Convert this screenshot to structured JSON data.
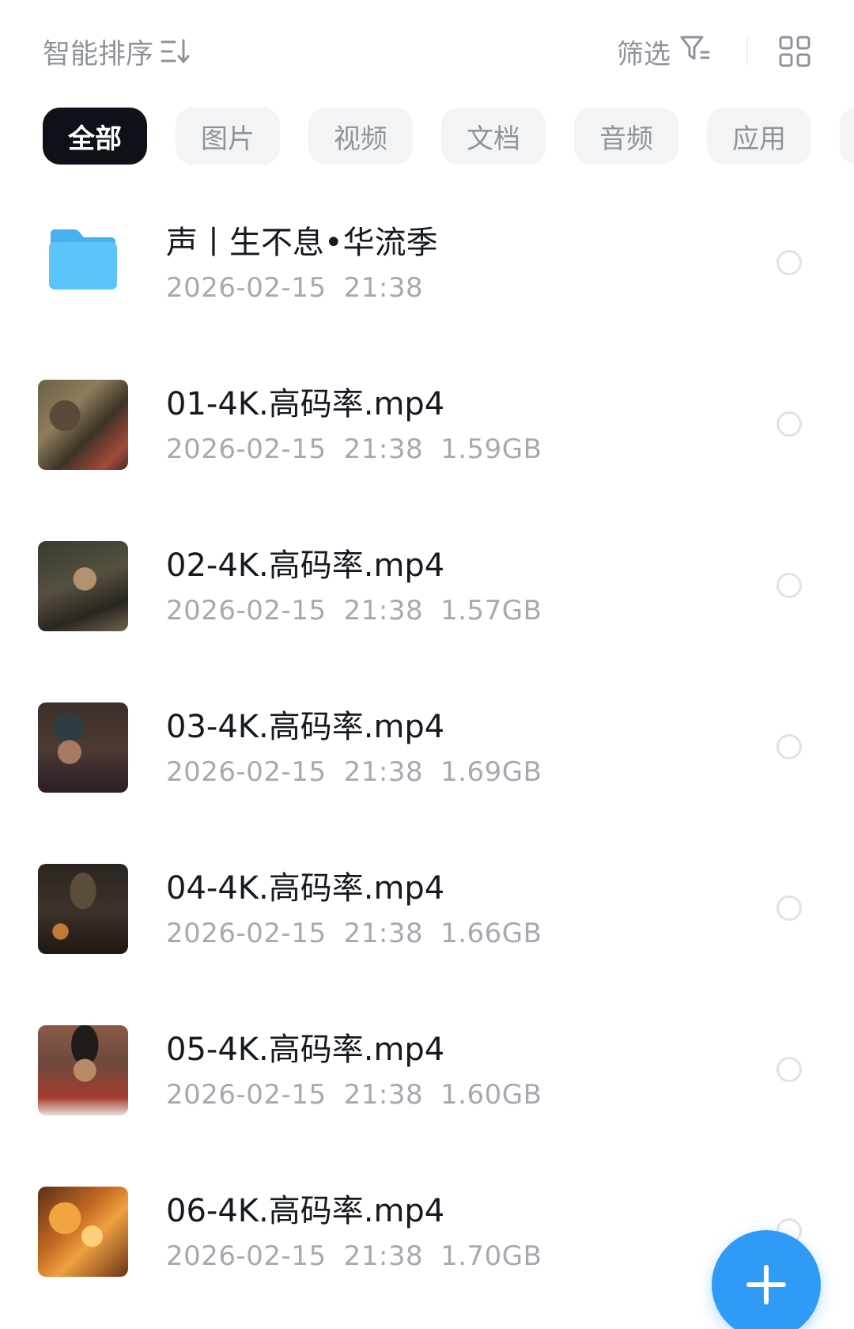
{
  "toolbar": {
    "sort_label": "智能排序",
    "filter_label": "筛选"
  },
  "tabs": [
    "全部",
    "图片",
    "视频",
    "文档",
    "音频",
    "应用"
  ],
  "files": [
    {
      "name": "声丨生不息•华流季",
      "date": "2026-02-15",
      "time": "21:38",
      "size": "",
      "type": "folder"
    },
    {
      "name": "01-4K.高码率.mp4",
      "date": "2026-02-15",
      "time": "21:38",
      "size": "1.59GB",
      "type": "video"
    },
    {
      "name": "02-4K.高码率.mp4",
      "date": "2026-02-15",
      "time": "21:38",
      "size": "1.57GB",
      "type": "video"
    },
    {
      "name": "03-4K.高码率.mp4",
      "date": "2026-02-15",
      "time": "21:38",
      "size": "1.69GB",
      "type": "video"
    },
    {
      "name": "04-4K.高码率.mp4",
      "date": "2026-02-15",
      "time": "21:38",
      "size": "1.66GB",
      "type": "video"
    },
    {
      "name": "05-4K.高码率.mp4",
      "date": "2026-02-15",
      "time": "21:38",
      "size": "1.60GB",
      "type": "video"
    },
    {
      "name": "06-4K.高码率.mp4",
      "date": "2026-02-15",
      "time": "21:38",
      "size": "1.70GB",
      "type": "video"
    }
  ],
  "icons": {
    "sort": "sort-icon",
    "filter": "filter-icon",
    "view": "grid-view-icon",
    "folder": "folder-icon",
    "add": "plus-icon"
  },
  "colors": {
    "active_tab": "#0c1218",
    "folder": "#56bff8",
    "fab": "#2f9bf7"
  }
}
